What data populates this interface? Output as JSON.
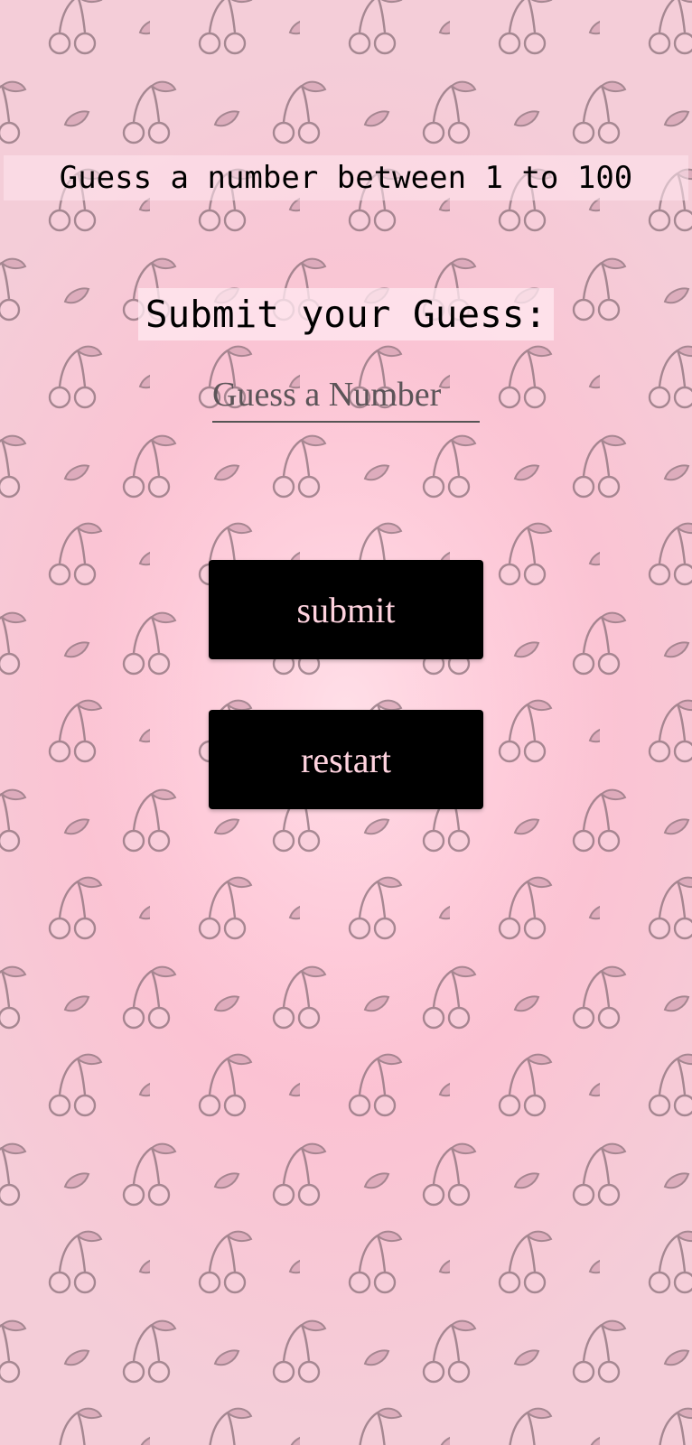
{
  "game": {
    "instruction": "Guess a number between 1 to 100",
    "prompt": "Submit your Guess:",
    "input_placeholder": "Guess a Number",
    "submit_label": "submit",
    "restart_label": "restart"
  },
  "theme": {
    "background": "#ffb8ce",
    "button_bg": "#000000",
    "button_text": "#ffd3df",
    "pattern_icon": "cherry-icon"
  }
}
